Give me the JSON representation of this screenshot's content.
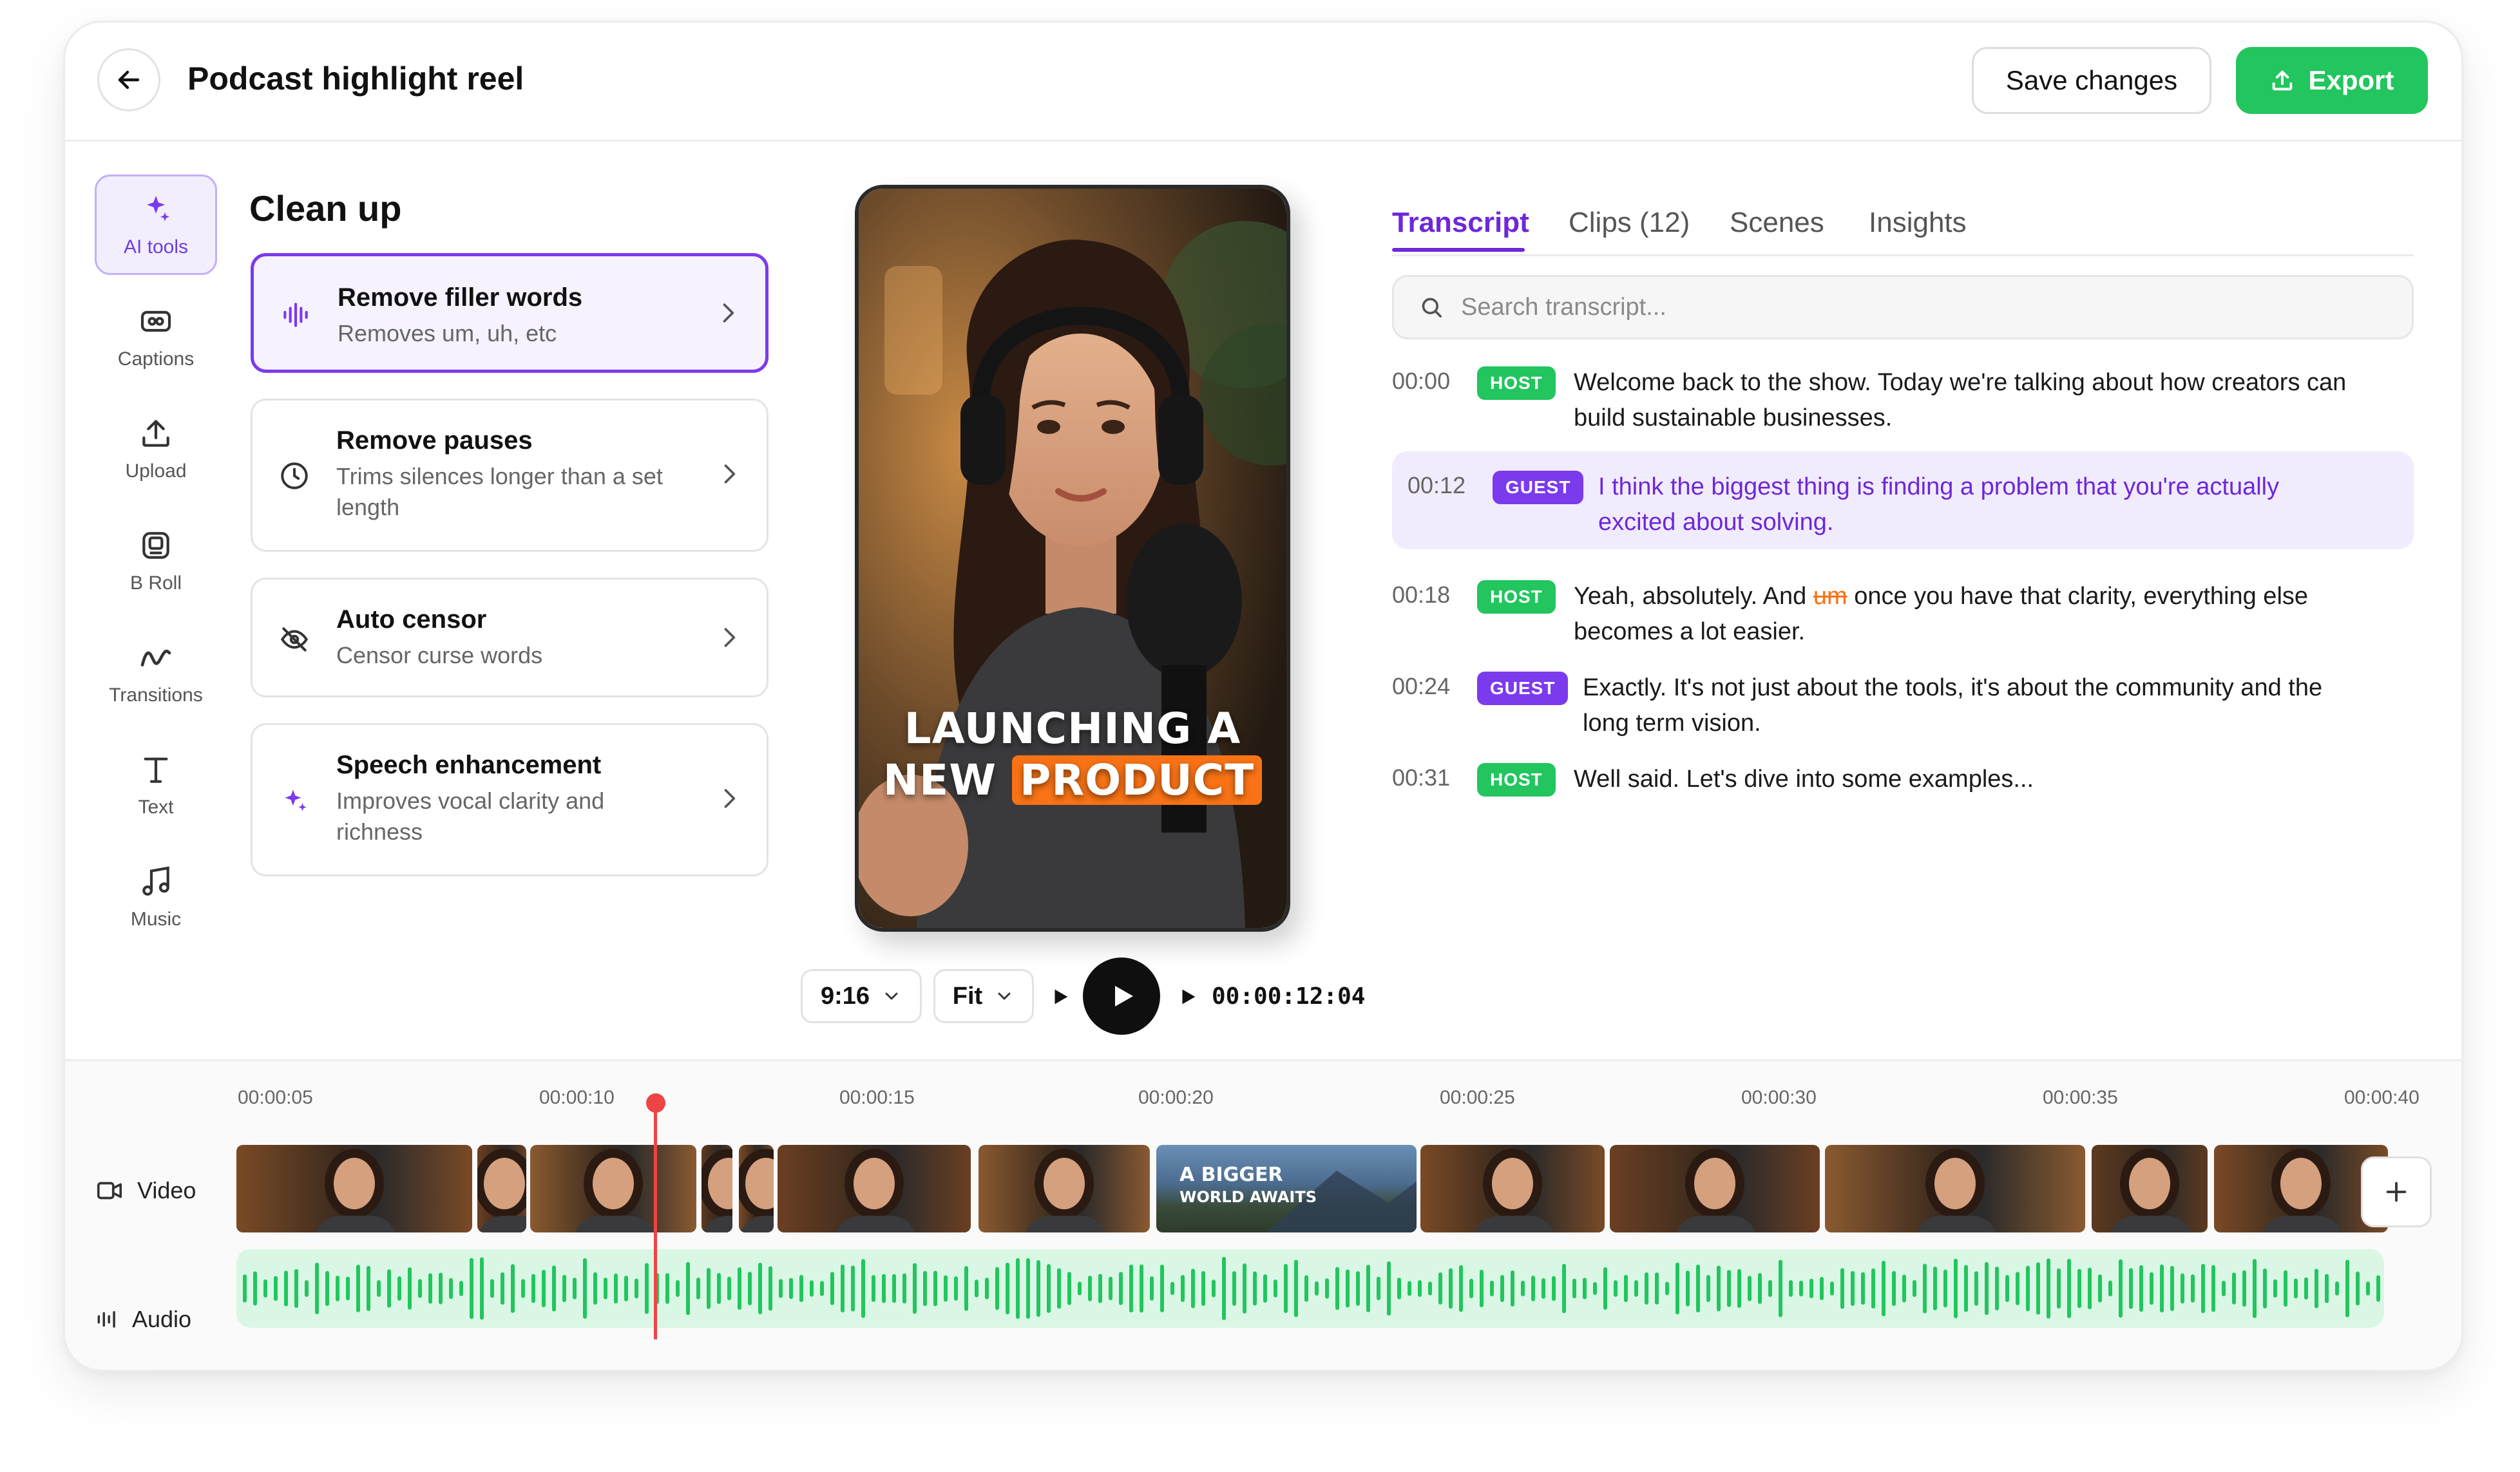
{
  "header": {
    "title": "Podcast highlight reel",
    "save_label": "Save changes",
    "export_label": "Export"
  },
  "rail": {
    "items": [
      {
        "label": "AI tools",
        "icon": "sparkles-icon",
        "active": true
      },
      {
        "label": "Captions",
        "icon": "captions-icon"
      },
      {
        "label": "Upload",
        "icon": "upload-icon"
      },
      {
        "label": "B Roll",
        "icon": "b-roll-icon"
      },
      {
        "label": "Transitions",
        "icon": "wave-icon"
      },
      {
        "label": "Text",
        "icon": "text-icon"
      },
      {
        "label": "Music",
        "icon": "music-icon"
      }
    ]
  },
  "cleanup": {
    "title": "Clean up",
    "tools": [
      {
        "name": "Remove filler words",
        "desc": "Removes um, uh, etc",
        "icon": "waveform-icon"
      },
      {
        "name": "Remove pauses",
        "desc": "Trims silences longer than a set length",
        "icon": "clock-icon"
      },
      {
        "name": "Auto censor",
        "desc": "Censor curse words",
        "icon": "eye-off-icon"
      },
      {
        "name": "Speech enhancement",
        "desc": "Improves vocal clarity and richness",
        "icon": "sparkles-icon"
      }
    ]
  },
  "preview": {
    "caption_line1": "LAUNCHING A",
    "caption_line2a": "NEW",
    "caption_line2b": "PRODUCT"
  },
  "controls": {
    "aspect": "9:16",
    "fit": "Fit",
    "timecode": "00:00:12:04"
  },
  "tabs": [
    {
      "label": "Transcript"
    },
    {
      "label": "Clips (12)"
    },
    {
      "label": "Scenes"
    },
    {
      "label": "Insights"
    }
  ],
  "search": {
    "placeholder": "Search transcript..."
  },
  "transcript": [
    {
      "time": "00:00",
      "speaker": "HOST",
      "line1": "Welcome back to the show. Today we're talking about how creators can",
      "line2": "build sustainable businesses."
    },
    {
      "time": "00:12",
      "speaker": "GUEST",
      "line1": "I think the biggest thing is finding a problem that you're actually",
      "line2": "excited about solving."
    },
    {
      "time": "00:18",
      "speaker": "HOST",
      "pre": "Yeah, absolutely. And",
      "filler": "um",
      "post": "once you have that clarity, everything else",
      "line2": "becomes a lot easier."
    },
    {
      "time": "00:24",
      "speaker": "GUEST",
      "line1": "Exactly. It's not just about the tools, it's about the community and the",
      "line2": "long term vision."
    },
    {
      "time": "00:31",
      "speaker": "HOST",
      "line1": "Well said. Let's dive into some examples..."
    }
  ],
  "timeline": {
    "ticks": [
      "00:00:05",
      "00:00:10",
      "00:00:15",
      "00:00:20",
      "00:00:25",
      "00:00:30",
      "00:00:35",
      "00:00:40"
    ],
    "video_label": "Video",
    "audio_label": "Audio",
    "broll_line1": "A BIGGER",
    "broll_line2": "WORLD AWAITS"
  },
  "colors": {
    "accent": "#7c3aed",
    "export": "#22c55e",
    "playhead": "#ef4444",
    "audio": "#22c55e",
    "filler": "#f97316"
  }
}
